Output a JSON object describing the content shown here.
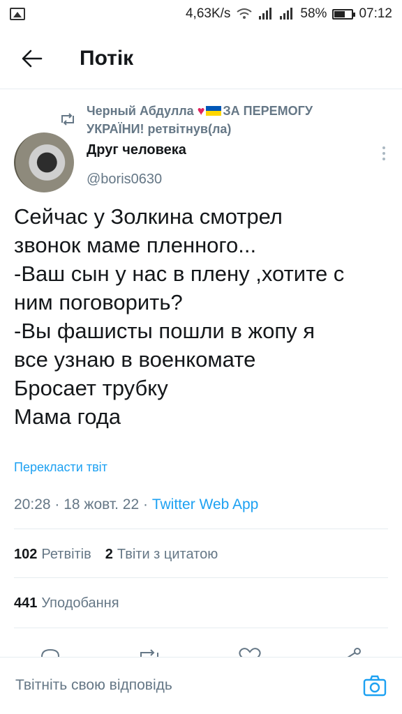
{
  "status_bar": {
    "speed": "4,63K/s",
    "battery": "58%",
    "time": "07:12",
    "icons": [
      "image-icon",
      "wifi-icon",
      "signal-icon",
      "signal-icon",
      "battery-icon"
    ]
  },
  "header": {
    "title": "Потік"
  },
  "retweet": {
    "name_part1": "Черный Абдулла",
    "name_part2": "ЗА ПЕРЕМОГУ УКРАЇНИ!",
    "action": "ретвітнув(ла)"
  },
  "author": {
    "name": "Друг человека",
    "handle": "@boris0630"
  },
  "tweet": {
    "text": "Сейчас у Золкина смотрел\nзвонок маме пленного...\n-Ваш сын у нас в плену ,хотите с\nним поговорить?\n-Вы фашисты пошли в жопу я\nвсе узнаю в военкомате\nБросает трубку\nМама года",
    "translate_label": "Перекласти твіт",
    "time": "20:28",
    "date": "18 жовт. 22",
    "source": "Twitter Web App"
  },
  "stats": {
    "retweets_count": "102",
    "retweets_label": "Ретвітів",
    "quotes_count": "2",
    "quotes_label": "Твіти з цитатою",
    "likes_count": "441",
    "likes_label": "Уподобання"
  },
  "reply": {
    "placeholder": "Твітніть свою відповідь"
  },
  "colors": {
    "accent": "#1da1f2",
    "secondary_text": "#657786",
    "heart": "#e0245e",
    "flag_blue": "#0057b7",
    "flag_yellow": "#ffd700"
  }
}
